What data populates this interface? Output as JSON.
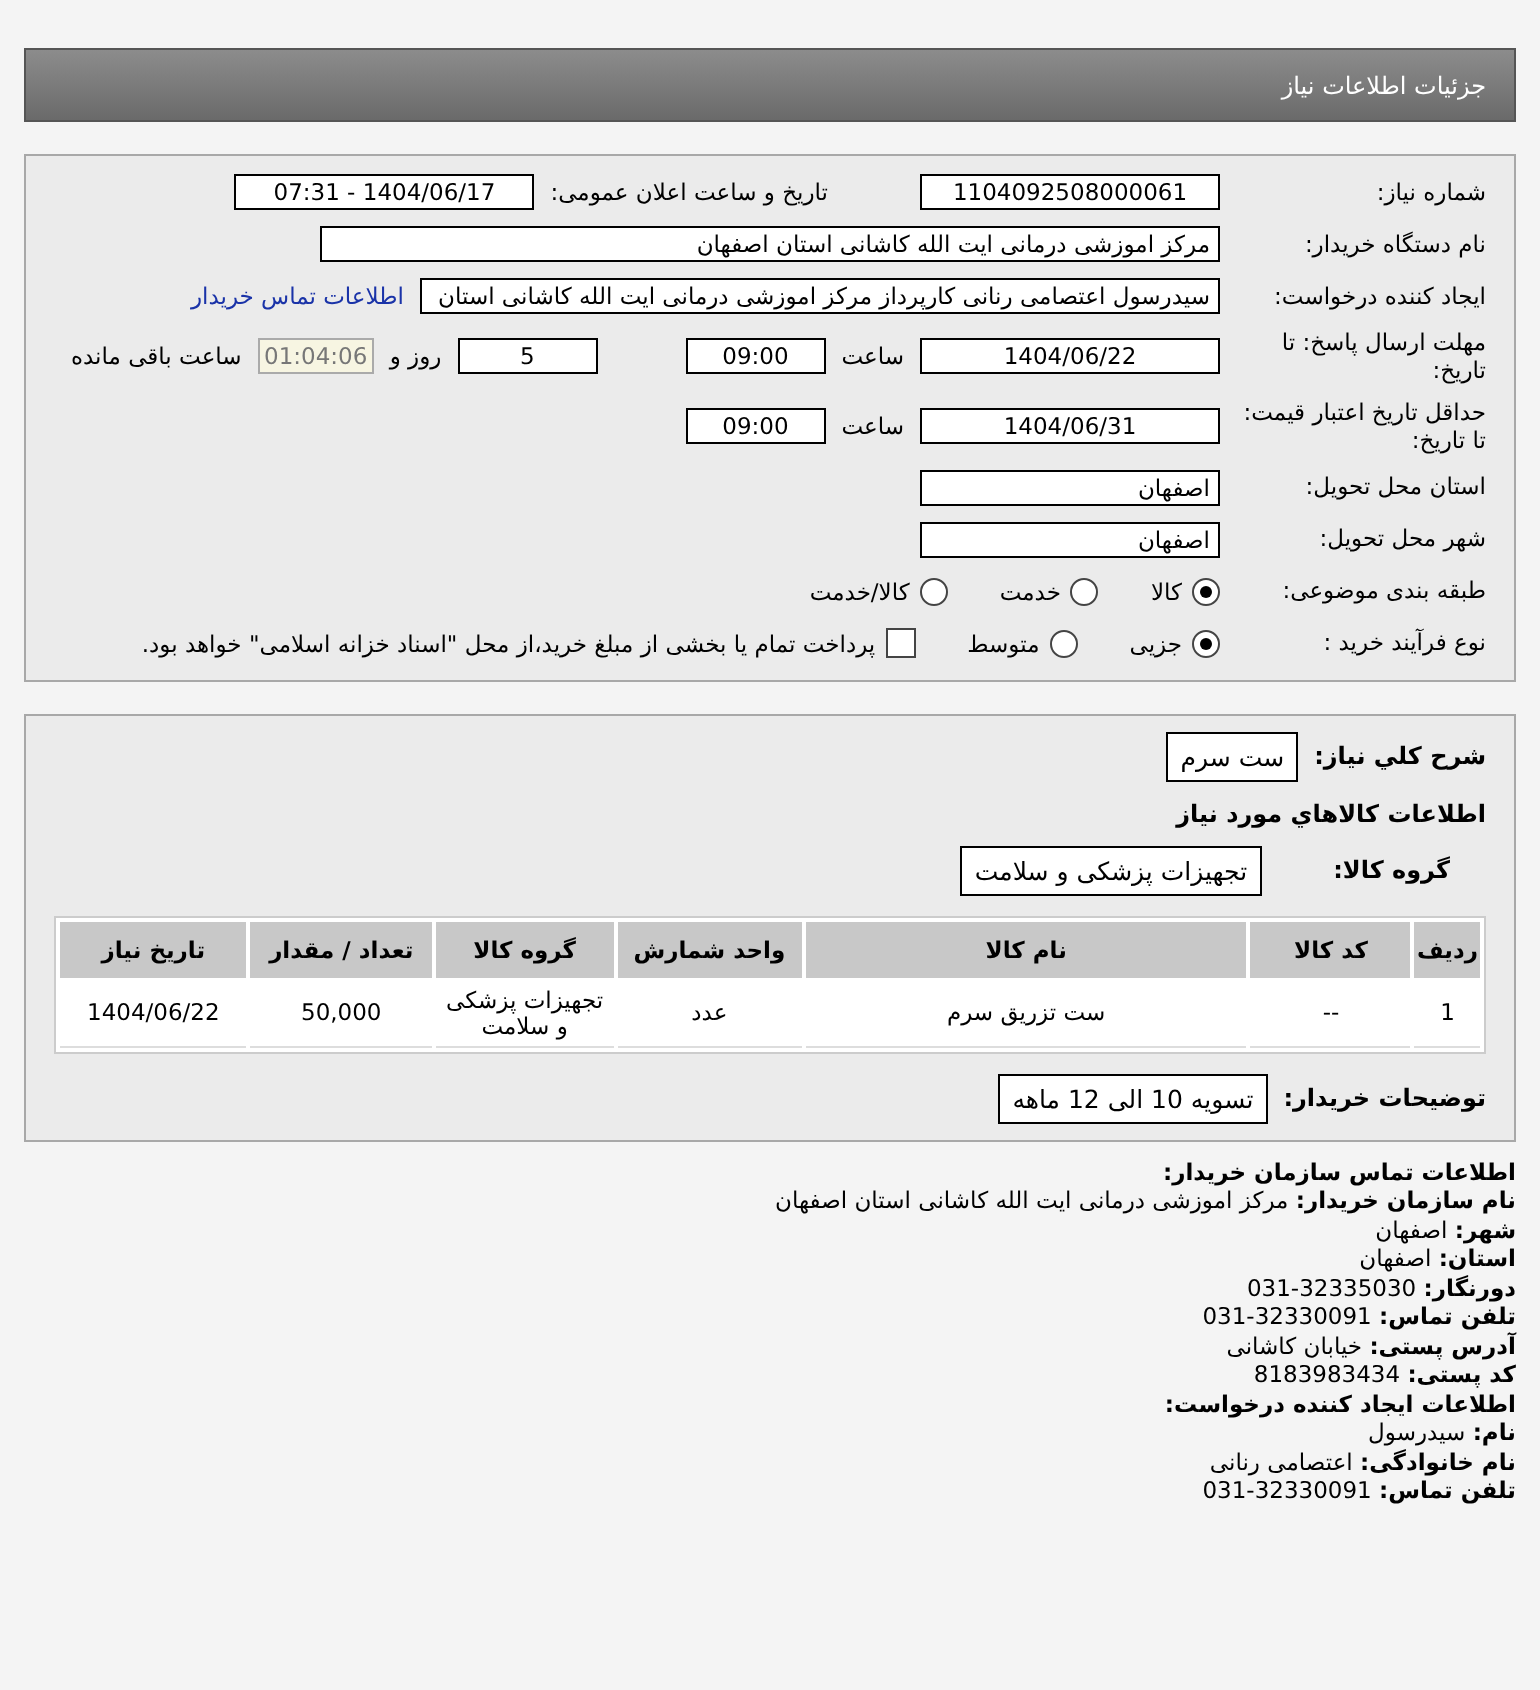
{
  "header": {
    "title": "جزئیات اطلاعات نیاز"
  },
  "need_number": {
    "label": "شماره نیاز:",
    "value": "1104092508000061"
  },
  "announce": {
    "label": "تاریخ و ساعت اعلان عمومی:",
    "value": "1404/06/17 - 07:31"
  },
  "buyer": {
    "label": "نام دستگاه خریدار:",
    "value": "مرکز اموزشی درمانی ایت الله کاشانی استان اصفهان"
  },
  "creator": {
    "label": "ایجاد کننده درخواست:",
    "value": "سیدرسول اعتصامی رنانی کارپرداز مرکز اموزشی درمانی ایت الله کاشانی استان",
    "link": "اطلاعات تماس خریدار"
  },
  "deadline": {
    "label": "مهلت ارسال پاسخ: تا تاریخ:",
    "date": "1404/06/22",
    "time_label": "ساعت",
    "time": "09:00",
    "days": "5",
    "days_label": "روز و",
    "remaining": "01:04:06",
    "remaining_label": "ساعت باقی مانده"
  },
  "validity": {
    "label": "حداقل تاریخ اعتبار قیمت: تا تاریخ:",
    "date": "1404/06/31",
    "time_label": "ساعت",
    "time": "09:00"
  },
  "province": {
    "label": "استان محل تحویل:",
    "value": "اصفهان"
  },
  "city": {
    "label": "شهر محل تحویل:",
    "value": "اصفهان"
  },
  "category": {
    "label": "طبقه بندی موضوعی:",
    "options": [
      {
        "label": "کالا",
        "selected": true
      },
      {
        "label": "خدمت",
        "selected": false
      },
      {
        "label": "کالا/خدمت",
        "selected": false
      }
    ]
  },
  "process": {
    "label": "نوع فرآیند خرید :",
    "options": [
      {
        "label": "جزیی",
        "selected": true
      },
      {
        "label": "متوسط",
        "selected": false
      }
    ],
    "payment": {
      "label": "پرداخت تمام یا بخشی از مبلغ خرید،از محل \"اسناد خزانه اسلامی\" خواهد بود.",
      "checked": false
    }
  },
  "summary": {
    "label": "شرح کلي نياز:",
    "value": "ست سرم"
  },
  "goods_title": "اطلاعات كالاهاي مورد نياز",
  "goods_group": {
    "label": "گروه کالا:",
    "value": "تجهیزات پزشکی و سلامت"
  },
  "table": {
    "columns": [
      "ردیف",
      "کد کالا",
      "نام کالا",
      "واحد شمارش",
      "گروه کالا",
      "تعداد / مقدار",
      "تاریخ نیاز"
    ],
    "rows": [
      [
        "1",
        "--",
        "ست تزریق سرم",
        "عدد",
        "تجهیزات پزشکی و سلامت",
        "50,000",
        "1404/06/22"
      ]
    ]
  },
  "buyer_notes": {
    "label": "توضیحات خریدار:",
    "value": "تسویه 10 الی 12 ماهه"
  },
  "contact": [
    {
      "kind": "heading",
      "text": "اطلاعات تماس سازمان خریدار:"
    },
    {
      "kind": "line",
      "text": "**نام سازمان خریدار:** مرکز اموزشی درمانی ایت الله کاشانی استان اصفهان"
    },
    {
      "kind": "line",
      "text": "**شهر:** اصفهان"
    },
    {
      "kind": "line",
      "text": "**استان:** اصفهان"
    },
    {
      "kind": "line",
      "text": "**دورنگار:** 32335030-031"
    },
    {
      "kind": "line",
      "text": "**تلفن تماس:** 32330091-031"
    },
    {
      "kind": "line",
      "text": "**آدرس پستی:** خیابان کاشانی"
    },
    {
      "kind": "line",
      "text": "**کد پستی:** 8183983434"
    },
    {
      "kind": "heading",
      "text": "اطلاعات ایجاد کننده درخواست:"
    },
    {
      "kind": "line",
      "text": "**نام:** سیدرسول"
    },
    {
      "kind": "line",
      "text": "**نام خانوادگی:** اعتصامی رنانی"
    },
    {
      "kind": "line",
      "text": "**تلفن تماس:** 32330091-031"
    }
  ]
}
